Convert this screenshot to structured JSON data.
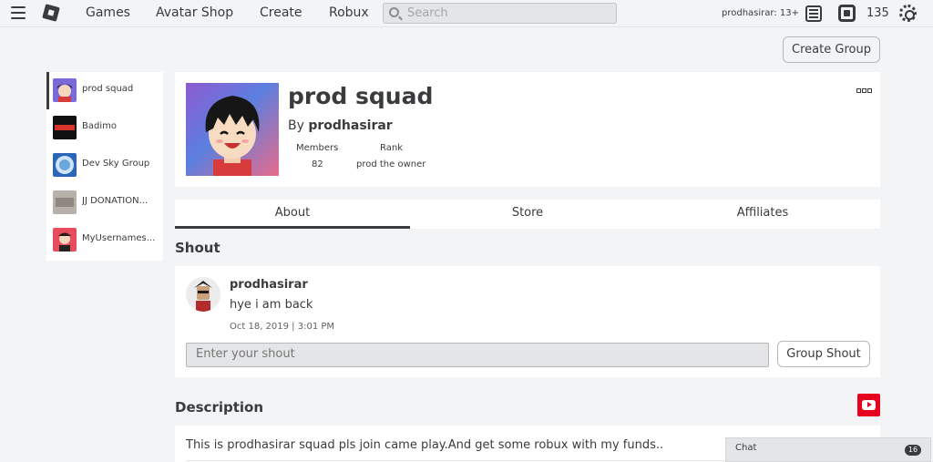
{
  "topbar": {
    "nav": [
      "Games",
      "Avatar Shop",
      "Create",
      "Robux"
    ],
    "search_placeholder": "Search",
    "username": "prodhasirar: 13+",
    "robux": "135"
  },
  "actions": {
    "create_group": "Create Group"
  },
  "sidebar": {
    "items": [
      {
        "label": "prod squad",
        "active": true
      },
      {
        "label": "Badimo",
        "active": false
      },
      {
        "label": "Dev Sky Group",
        "active": false
      },
      {
        "label": "JJ DONATION...",
        "active": false
      },
      {
        "label": "MyUsernames...",
        "active": false
      }
    ]
  },
  "group": {
    "name": "prod squad",
    "by_prefix": "By",
    "owner": "prodhasirar",
    "members_label": "Members",
    "members_value": "82",
    "rank_label": "Rank",
    "rank_value": "prod the owner"
  },
  "tabs": [
    "About",
    "Store",
    "Affiliates"
  ],
  "shout": {
    "title": "Shout",
    "author": "prodhasirar",
    "text": "hye i am back",
    "date": "Oct 18, 2019 | 3:01 PM",
    "input_placeholder": "Enter your shout",
    "button": "Group Shout"
  },
  "description": {
    "title": "Description",
    "text": "This is prodhasirar squad pls join came play.And get some robux with my funds.."
  },
  "chat": {
    "label": "Chat",
    "count": "16"
  },
  "colors": {
    "accent": "#393b3d",
    "youtube": "#e8001f",
    "background": "#f2f4f5"
  }
}
